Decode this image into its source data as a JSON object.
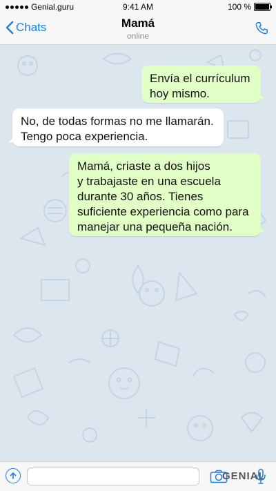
{
  "status_bar": {
    "carrier": "Genial.guru",
    "time": "9:41 AM",
    "battery": "100 %"
  },
  "nav": {
    "back_label": "Chats",
    "contact_name": "Mamá",
    "contact_status": "online",
    "icons": {
      "back": "chevron-left-icon",
      "call": "phone-icon"
    }
  },
  "messages": [
    {
      "direction": "out",
      "lines": [
        "Envía el currículum",
        "hoy mismo."
      ]
    },
    {
      "direction": "in",
      "lines": [
        "No, de todas formas no me llamarán.",
        "Tengo poca experiencia."
      ]
    },
    {
      "direction": "out",
      "lines": [
        "Mamá, criaste a dos hijos",
        "y trabajaste en una escuela",
        "durante 30 años. Tienes",
        "suficiente experiencia como para",
        "manejar una pequeña nación."
      ]
    }
  ],
  "input_bar": {
    "placeholder": "",
    "watermark": "GENIAL",
    "icons": {
      "attach": "attach-arrow-icon",
      "camera": "camera-icon",
      "mic": "microphone-icon"
    }
  },
  "colors": {
    "accent": "#1e7fd6",
    "chat_background": "#dce6ef",
    "outgoing_bubble": "#e1fec6",
    "incoming_bubble": "#ffffff"
  }
}
